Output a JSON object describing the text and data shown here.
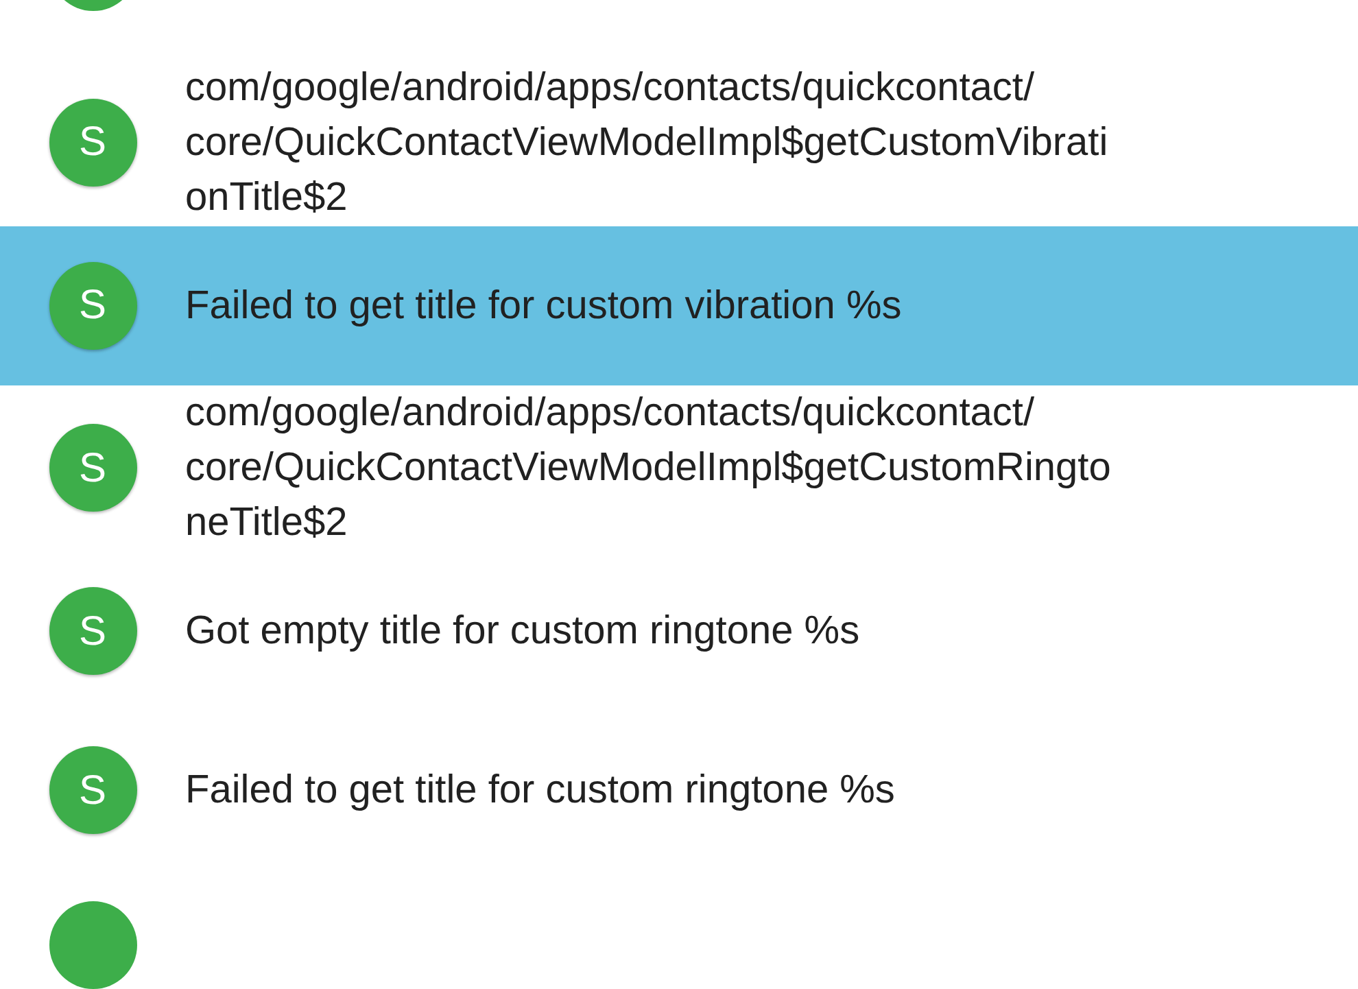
{
  "items": [
    {
      "kind": "partial-top"
    },
    {
      "kind": "entry",
      "avatar": "S",
      "selected": false,
      "lines": [
        "com/google/android/apps/contacts/quickcontact/",
        "core/QuickContactViewModelImpl$getCustomVibrati",
        "onTitle$2"
      ]
    },
    {
      "kind": "entry",
      "avatar": "S",
      "selected": true,
      "lines": [
        "Failed to get title for custom vibration %s"
      ]
    },
    {
      "kind": "entry",
      "avatar": "S",
      "selected": false,
      "lines": [
        "com/google/android/apps/contacts/quickcontact/",
        "core/QuickContactViewModelImpl$getCustomRingto",
        "neTitle$2"
      ]
    },
    {
      "kind": "entry",
      "avatar": "S",
      "selected": false,
      "lines": [
        "Got empty title for custom ringtone %s"
      ]
    },
    {
      "kind": "entry",
      "avatar": "S",
      "selected": false,
      "lines": [
        "Failed to get title for custom ringtone %s"
      ]
    },
    {
      "kind": "partial-bottom"
    }
  ]
}
